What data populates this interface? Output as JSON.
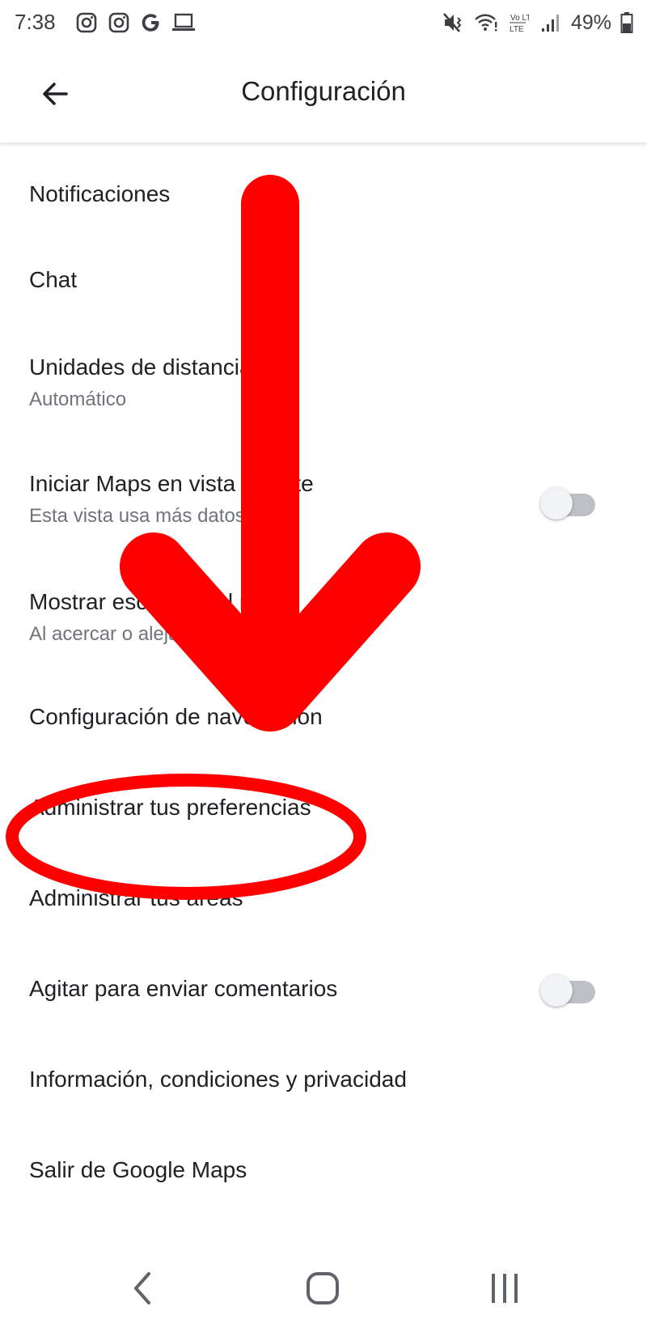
{
  "status_bar": {
    "time": "7:38",
    "left_icons": [
      "instagram-icon",
      "instagram-icon",
      "google-icon",
      "laptop-icon"
    ],
    "right_icons": [
      "mute-vibrate-icon",
      "wifi-icon",
      "volte-icon",
      "signal-icon",
      "battery-icon"
    ],
    "battery_percent": "49%",
    "volte_label": "Vo LTE"
  },
  "app_bar": {
    "title": "Configuración",
    "back_icon": "arrow-back-icon"
  },
  "settings": {
    "items": [
      {
        "title": "Notificaciones"
      },
      {
        "title": "Chat"
      },
      {
        "title": "Unidades de distancia",
        "subtitle": "Automático"
      },
      {
        "title": "Iniciar Maps en vista satélite",
        "subtitle": "Esta vista usa más datos",
        "toggle": false
      },
      {
        "title": "Mostrar escala en el mapa",
        "subtitle": "Al acercar o alejar el mapa"
      },
      {
        "title": "Configuración de navegación"
      },
      {
        "title": "Administrar tus preferencias"
      },
      {
        "title": "Administrar tus áreas"
      },
      {
        "title": "Agitar para enviar comentarios",
        "toggle": false
      },
      {
        "title": "Información, condiciones y privacidad"
      },
      {
        "title": "Salir de Google Maps"
      }
    ]
  },
  "nav_bar": {
    "buttons": [
      "back-nav-icon",
      "home-nav-icon",
      "recents-nav-icon"
    ]
  },
  "annotation": {
    "color": "#ff0000",
    "highlighted_item": "Administrar tus preferencias"
  }
}
